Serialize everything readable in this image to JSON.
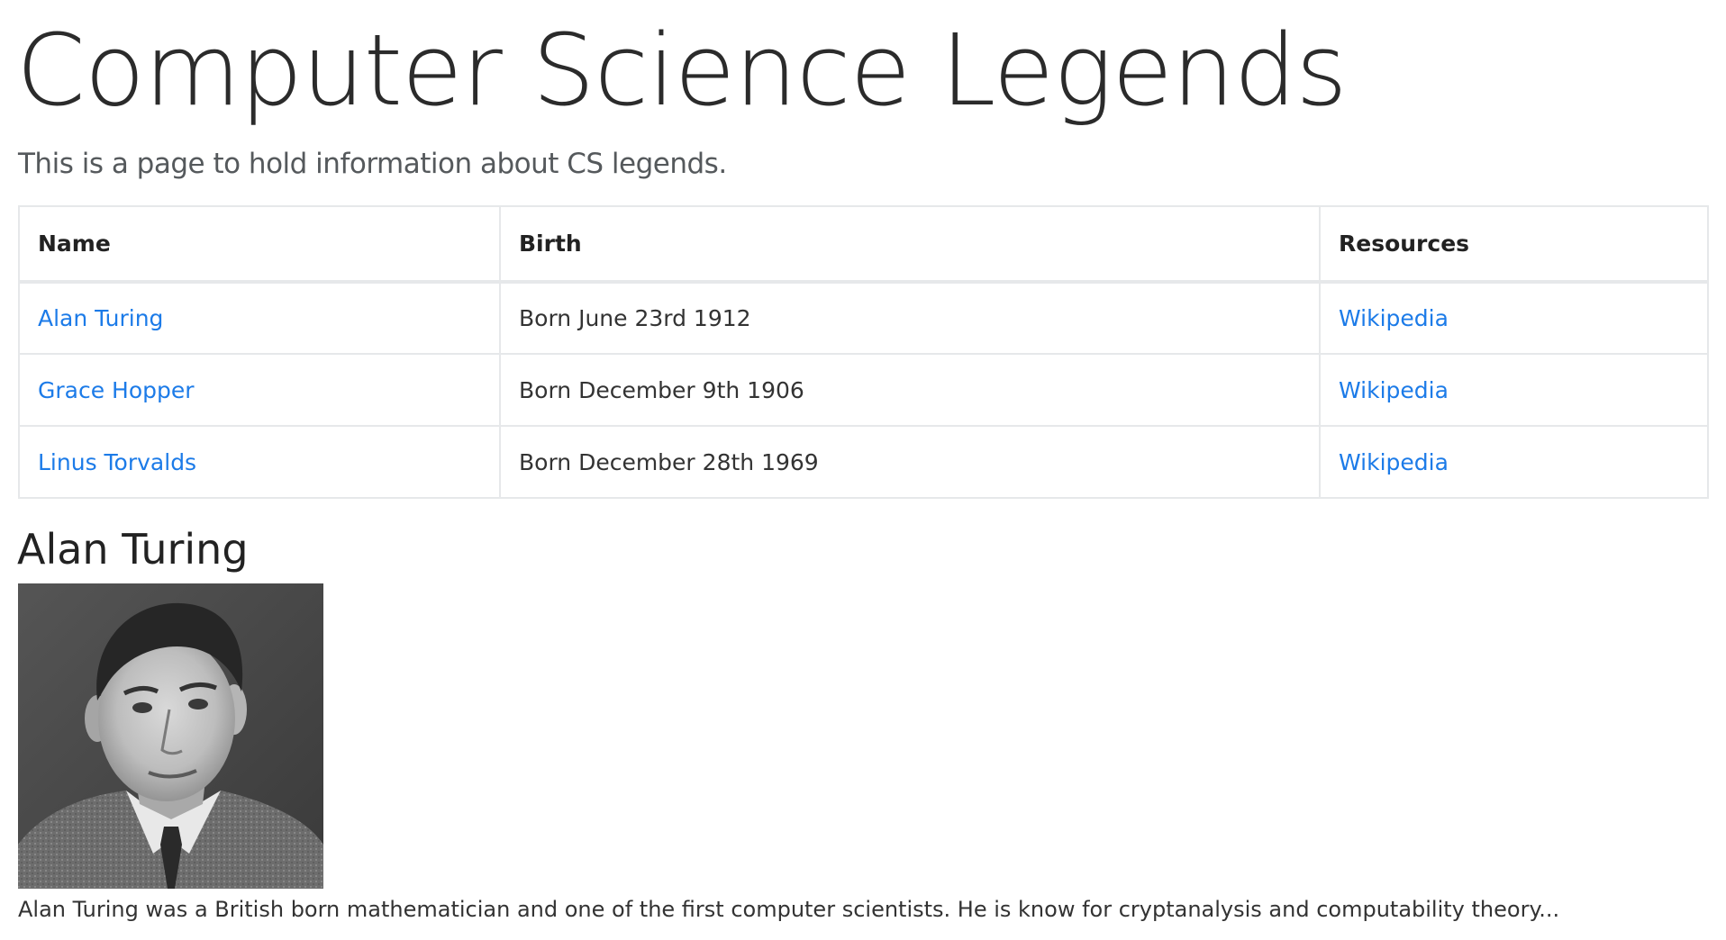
{
  "page": {
    "title": "Computer Science Legends",
    "lead": "This is a page to hold information about CS legends."
  },
  "table": {
    "headers": [
      "Name",
      "Birth",
      "Resources"
    ],
    "rows": [
      {
        "name": "Alan Turing",
        "birth": "Born June 23rd 1912",
        "resource": "Wikipedia"
      },
      {
        "name": "Grace Hopper",
        "birth": "Born December 9th 1906",
        "resource": "Wikipedia"
      },
      {
        "name": "Linus Torvalds",
        "birth": "Born December 28th 1969",
        "resource": "Wikipedia"
      }
    ]
  },
  "detail": {
    "heading": "Alan Turing",
    "image_description": "black-and-white-portrait-photo",
    "bio": "Alan Turing was a British born mathematician and one of the first computer scientists. He is know for cryptanalysis and computability theory..."
  },
  "colors": {
    "link": "#1c7be8",
    "border": "#e6e8ea",
    "text": "#212529"
  }
}
